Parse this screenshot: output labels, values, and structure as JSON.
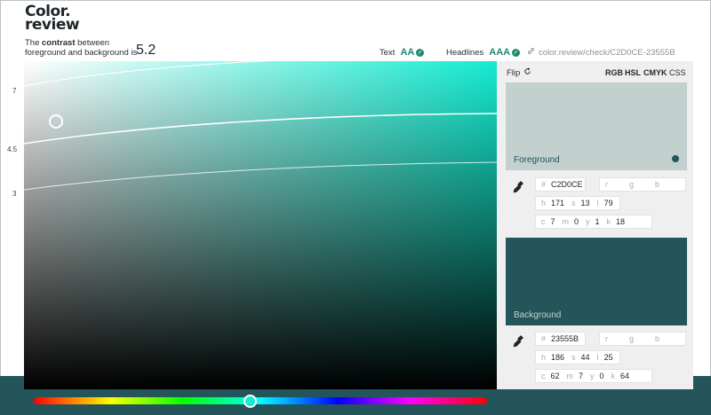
{
  "logo": {
    "line1": "Color.",
    "line2": "review"
  },
  "contrast": {
    "prefix": "The ",
    "bold": "contrast",
    "suffix1": " between",
    "line2": "foreground and background is",
    "ratio": "5.2"
  },
  "ratings": {
    "text_label": "Text",
    "text_grade": "AA",
    "headlines_label": "Headlines",
    "headlines_grade": "AAA",
    "check": "✓"
  },
  "share_link": "color.review/check/C2D0CE-23555B",
  "yaxis": [
    "7",
    "4.5",
    "3"
  ],
  "panel": {
    "flip_label": "Flip",
    "modes": [
      "RGB",
      "HSL",
      "CMYK",
      "CSS"
    ]
  },
  "foreground": {
    "label": "Foreground",
    "color": "#C2D0CE",
    "hex": "C2D0CE",
    "rgb_placeholders": [
      "r",
      "g",
      "b"
    ],
    "h": "171",
    "s": "13",
    "l": "79",
    "c": "7",
    "m": "0",
    "y": "1",
    "k": "18"
  },
  "background": {
    "label": "Background",
    "color": "#23555B",
    "hex": "23555B",
    "rgb_placeholders": [
      "r",
      "g",
      "b"
    ],
    "h": "186",
    "s": "44",
    "l": "25",
    "c": "62",
    "m": "7",
    "y": "0",
    "k": "64"
  },
  "keys": {
    "hash": "#",
    "h": "h",
    "s": "s",
    "l": "l",
    "c": "c",
    "m": "m",
    "y": "y",
    "k": "k"
  },
  "icons": {
    "link": "link-icon",
    "refresh": "refresh-icon",
    "dropper": "eyedropper-icon",
    "check": "check-circle-icon"
  },
  "colors": {
    "accent": "#1f8a70",
    "canvas_hue": "#14ebd0",
    "band": "#23555b"
  }
}
